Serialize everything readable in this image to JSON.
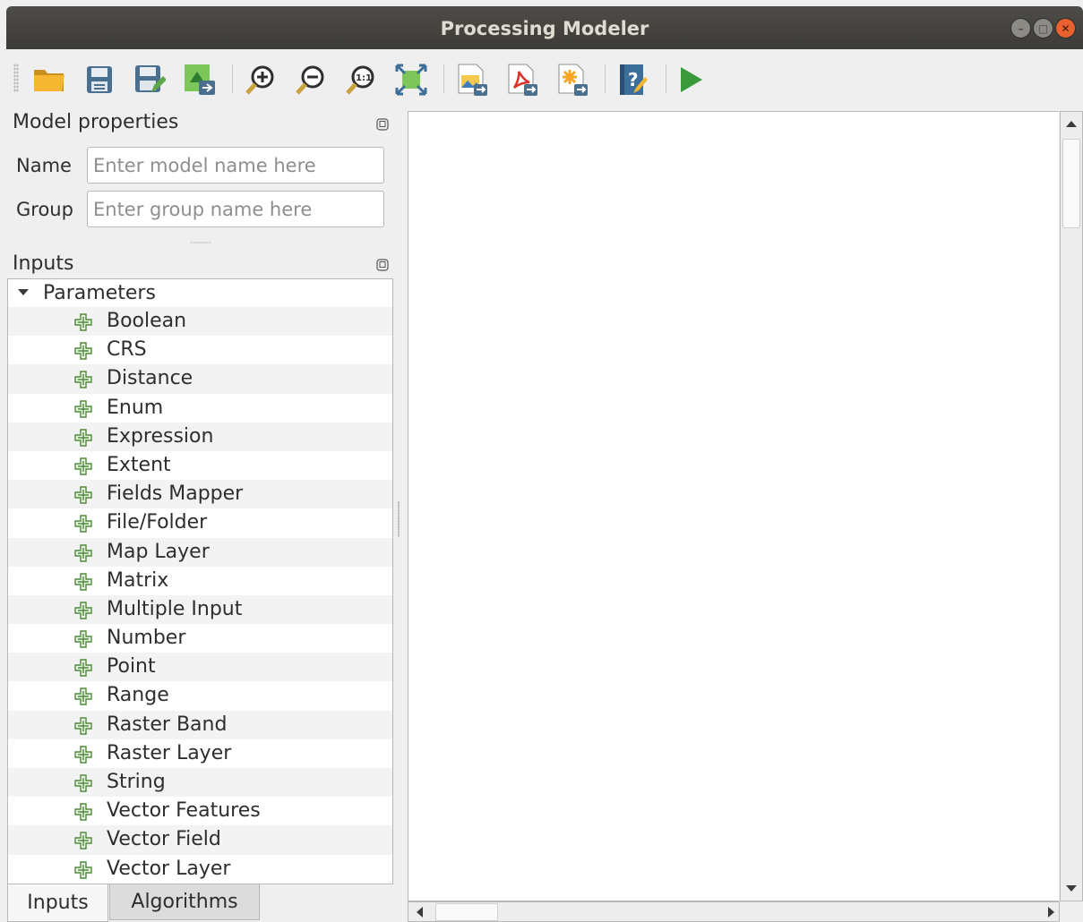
{
  "window": {
    "title": "Processing Modeler"
  },
  "toolbar": {
    "buttons": [
      "open-model-icon",
      "save-model-icon",
      "save-model-as-icon",
      "export-model-icon",
      "zoom-in-icon",
      "zoom-out-icon",
      "zoom-actual-icon",
      "zoom-full-icon",
      "export-image-icon",
      "export-pdf-icon",
      "export-svg-icon",
      "edit-help-icon",
      "run-model-icon"
    ]
  },
  "model_properties": {
    "title": "Model properties",
    "name_label": "Name",
    "name_placeholder": "Enter model name here",
    "group_label": "Group",
    "group_placeholder": "Enter group name here"
  },
  "inputs": {
    "title": "Inputs",
    "tree_root": "Parameters",
    "parameters": [
      "Boolean",
      "CRS",
      "Distance",
      "Enum",
      "Expression",
      "Extent",
      "Fields Mapper",
      "File/Folder",
      "Map Layer",
      "Matrix",
      "Multiple Input",
      "Number",
      "Point",
      "Range",
      "Raster Band",
      "Raster Layer",
      "String",
      "Vector Features",
      "Vector Field",
      "Vector Layer"
    ]
  },
  "tabs": {
    "inputs": "Inputs",
    "algorithms": "Algorithms"
  },
  "colors": {
    "titlebar": "#3c3b37",
    "close": "#e9612f",
    "run": "#3a9a3a",
    "plus": "#4f8a3c"
  }
}
